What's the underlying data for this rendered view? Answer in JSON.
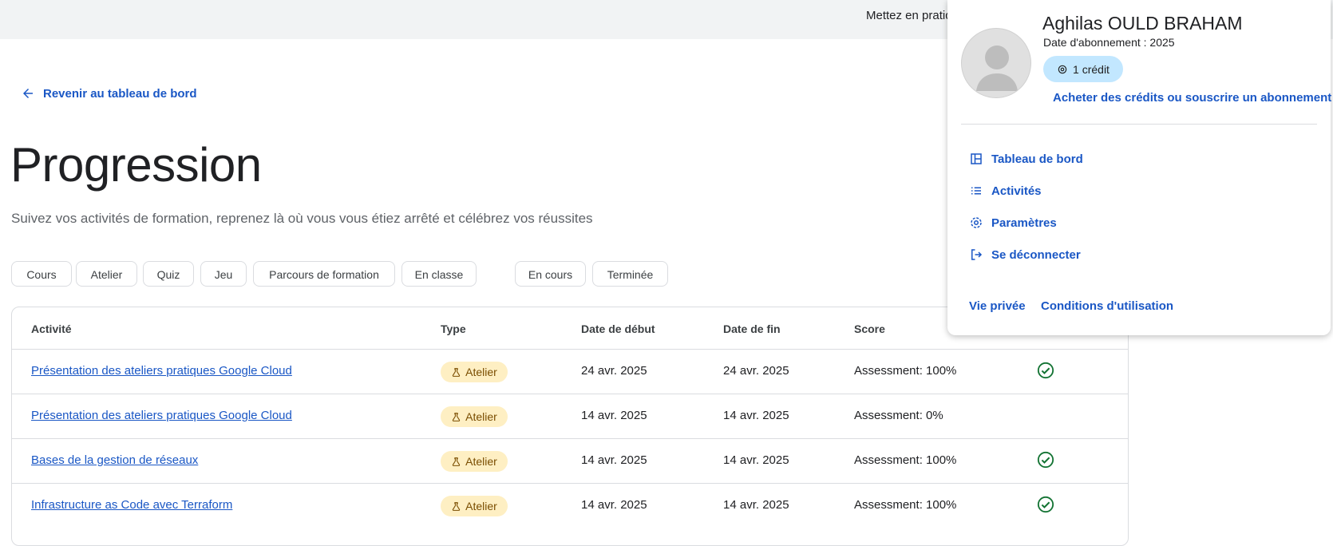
{
  "topbar": {
    "text": "Mettez en pratiq"
  },
  "back_link": {
    "label": "Revenir au tableau de bord",
    "icon": "arrow-left-icon"
  },
  "page": {
    "title": "Progression",
    "subtitle": "Suivez vos activités de formation, reprenez là où vous vous étiez arrêté et célébrez vos réussites"
  },
  "filters": {
    "type_chips": [
      "Cours",
      "Atelier",
      "Quiz",
      "Jeu",
      "Parcours de formation",
      "En classe"
    ],
    "status_chips": [
      "En cours",
      "Terminée"
    ]
  },
  "table": {
    "headers": [
      "Activité",
      "Type",
      "Date de début",
      "Date de fin",
      "Score"
    ],
    "rows": [
      {
        "activity": "Présentation des ateliers pratiques Google Cloud",
        "type": "Atelier",
        "start": "24 avr. 2025",
        "end": "24 avr. 2025",
        "score": "Assessment: 100%",
        "completed": true
      },
      {
        "activity": "Présentation des ateliers pratiques Google Cloud",
        "type": "Atelier",
        "start": "14 avr. 2025",
        "end": "14 avr. 2025",
        "score": "Assessment: 0%",
        "completed": false
      },
      {
        "activity": "Bases de la gestion de réseaux",
        "type": "Atelier",
        "start": "14 avr. 2025",
        "end": "14 avr. 2025",
        "score": "Assessment: 100%",
        "completed": true
      },
      {
        "activity": "Infrastructure as Code avec Terraform",
        "type": "Atelier",
        "start": "14 avr. 2025",
        "end": "14 avr. 2025",
        "score": "Assessment: 100%",
        "completed": true
      }
    ]
  },
  "account_menu": {
    "name": "Aghilas OULD BRAHAM",
    "subscription_date": "Date d'abonnement : 2025",
    "credits": "1 crédit",
    "buy_link": "Acheter des crédits ou souscrire un abonnement",
    "items": [
      {
        "label": "Tableau de bord",
        "icon": "dashboard-icon"
      },
      {
        "label": "Activités",
        "icon": "list-icon"
      },
      {
        "label": "Paramètres",
        "icon": "gear-icon"
      },
      {
        "label": "Se déconnecter",
        "icon": "logout-icon"
      }
    ],
    "footer_links": [
      "Vie privée",
      "Conditions d'utilisation"
    ]
  },
  "colors": {
    "link": "#1a57c5",
    "badge_bg": "#feefc3",
    "credit_bg": "#c2e7ff",
    "success": "#137333"
  }
}
